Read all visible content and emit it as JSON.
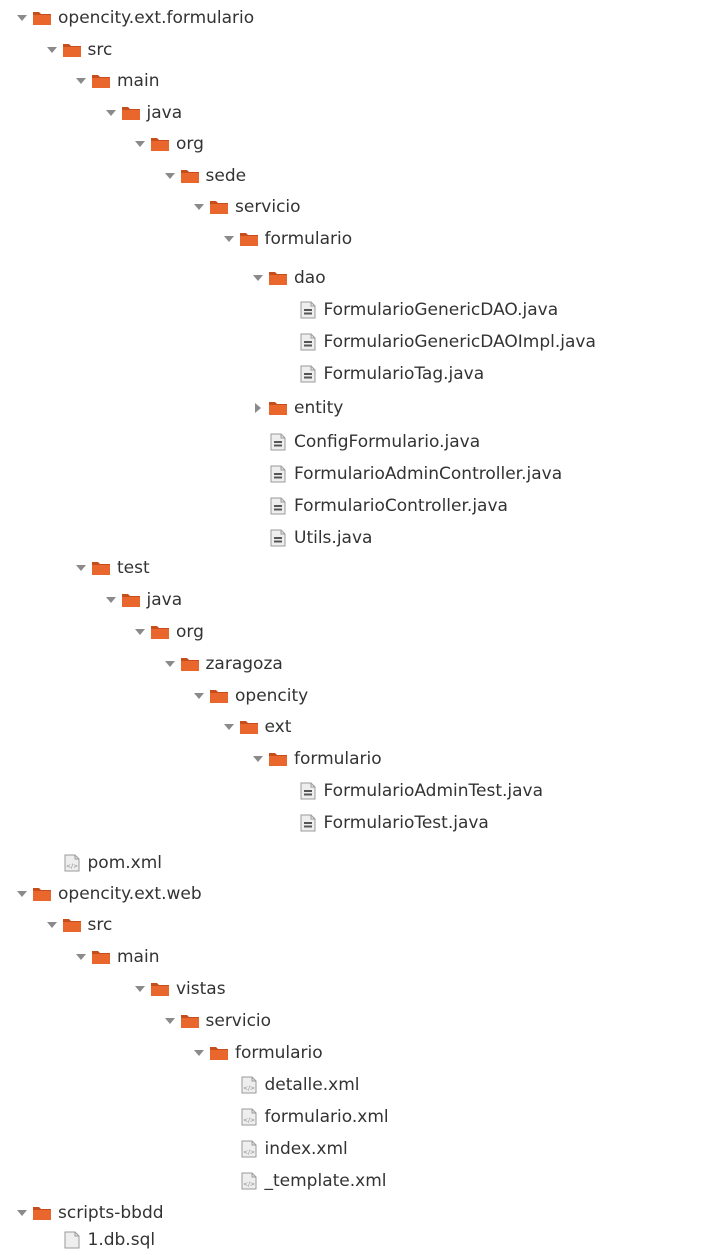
{
  "tree": {
    "rows": [
      {
        "label": "opencity.ext.formulario",
        "kind": "folder",
        "expanded": true,
        "depth": 0
      },
      {
        "label": "src",
        "kind": "folder",
        "expanded": true,
        "depth": 1
      },
      {
        "label": "main",
        "kind": "folder",
        "expanded": true,
        "depth": 2
      },
      {
        "label": "java",
        "kind": "folder",
        "expanded": true,
        "depth": 3
      },
      {
        "label": "org",
        "kind": "folder",
        "expanded": true,
        "depth": 4
      },
      {
        "label": "sede",
        "kind": "folder",
        "expanded": true,
        "depth": 5
      },
      {
        "label": "servicio",
        "kind": "folder",
        "expanded": true,
        "depth": 6
      },
      {
        "label": "formulario",
        "kind": "folder",
        "expanded": true,
        "depth": 7
      },
      {
        "label": "dao",
        "kind": "folder",
        "expanded": true,
        "depth": 8
      },
      {
        "label": "FormularioGenericDAO.java",
        "kind": "java-file",
        "depth": 9
      },
      {
        "label": "FormularioGenericDAOImpl.java",
        "kind": "java-file",
        "depth": 9
      },
      {
        "label": "FormularioTag.java",
        "kind": "java-file",
        "depth": 9
      },
      {
        "label": "entity",
        "kind": "folder",
        "expanded": false,
        "depth": 8
      },
      {
        "label": "ConfigFormulario.java",
        "kind": "java-file",
        "depth": 8
      },
      {
        "label": "FormularioAdminController.java",
        "kind": "java-file",
        "depth": 8
      },
      {
        "label": "FormularioController.java",
        "kind": "java-file",
        "depth": 8
      },
      {
        "label": "Utils.java",
        "kind": "java-file",
        "depth": 8
      },
      {
        "label": "test",
        "kind": "folder",
        "expanded": true,
        "depth": 2
      },
      {
        "label": "java",
        "kind": "folder",
        "expanded": true,
        "depth": 3
      },
      {
        "label": "org",
        "kind": "folder",
        "expanded": true,
        "depth": 4
      },
      {
        "label": "zaragoza",
        "kind": "folder",
        "expanded": true,
        "depth": 5
      },
      {
        "label": "opencity",
        "kind": "folder",
        "expanded": true,
        "depth": 6
      },
      {
        "label": "ext",
        "kind": "folder",
        "expanded": true,
        "depth": 7
      },
      {
        "label": "formulario",
        "kind": "folder",
        "expanded": true,
        "depth": 8
      },
      {
        "label": "FormularioAdminTest.java",
        "kind": "java-file",
        "depth": 9
      },
      {
        "label": "FormularioTest.java",
        "kind": "java-file",
        "depth": 9
      },
      {
        "label": "pom.xml",
        "kind": "xml-file",
        "depth": 1
      },
      {
        "label": "opencity.ext.web",
        "kind": "folder",
        "expanded": true,
        "depth": 0
      },
      {
        "label": "src",
        "kind": "folder",
        "expanded": true,
        "depth": 1
      },
      {
        "label": "main",
        "kind": "folder",
        "expanded": true,
        "depth": 2
      },
      {
        "label": "vistas",
        "kind": "folder",
        "expanded": true,
        "depth": 4
      },
      {
        "label": "servicio",
        "kind": "folder",
        "expanded": true,
        "depth": 5
      },
      {
        "label": "formulario",
        "kind": "folder",
        "expanded": true,
        "depth": 6
      },
      {
        "label": "detalle.xml",
        "kind": "xml-file",
        "depth": 7
      },
      {
        "label": "formulario.xml",
        "kind": "xml-file",
        "depth": 7
      },
      {
        "label": "index.xml",
        "kind": "xml-file",
        "depth": 7
      },
      {
        "label": "_template.xml",
        "kind": "xml-file",
        "depth": 7
      },
      {
        "label": "scripts-bbdd",
        "kind": "folder",
        "expanded": true,
        "depth": 0
      },
      {
        "label": "1.db.sql",
        "kind": "plain-file",
        "depth": 1
      }
    ]
  },
  "colors": {
    "folder_fill": "#e9672c",
    "folder_dark": "#c54e1c",
    "arrow": "#8a8a8a",
    "file_page": "#eeeeee",
    "file_border": "#9a9a9a",
    "text": "#333333"
  }
}
